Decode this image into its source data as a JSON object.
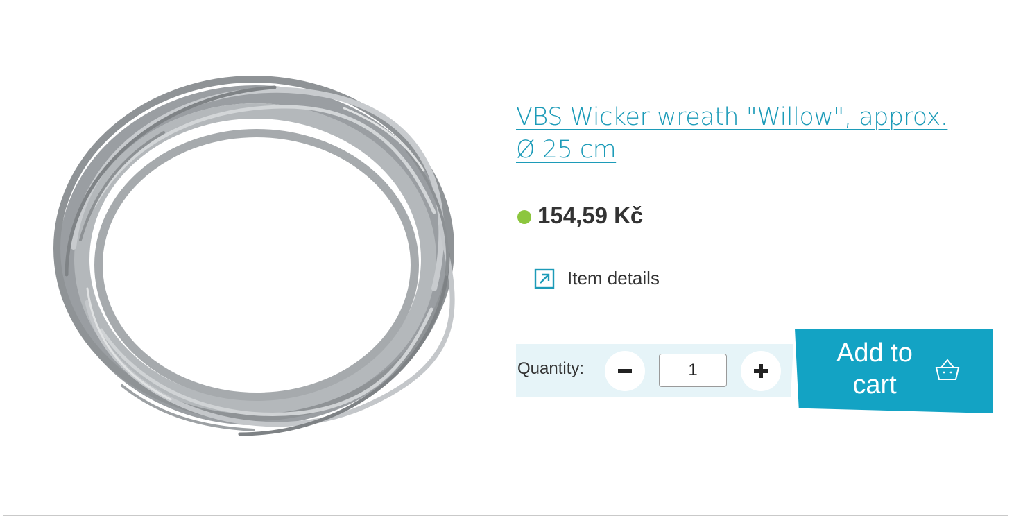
{
  "product": {
    "title": "VBS Wicker wreath \"Willow\", approx. Ø 25 cm",
    "price": "154,59 Kč",
    "stock_color": "#8cc63e",
    "image_icon": "wicker-wreath-image"
  },
  "details": {
    "label": "Item details",
    "icon": "external-link-arrow-icon"
  },
  "quantity": {
    "label": "Quantity:",
    "value": "1",
    "decrement_icon": "minus-icon",
    "increment_icon": "plus-icon"
  },
  "cart": {
    "label": "Add to cart",
    "icon": "basket-icon",
    "color": "#13a3c4"
  },
  "colors": {
    "accent": "#1c9bb8",
    "quantity_background": "#e6f4f8"
  }
}
